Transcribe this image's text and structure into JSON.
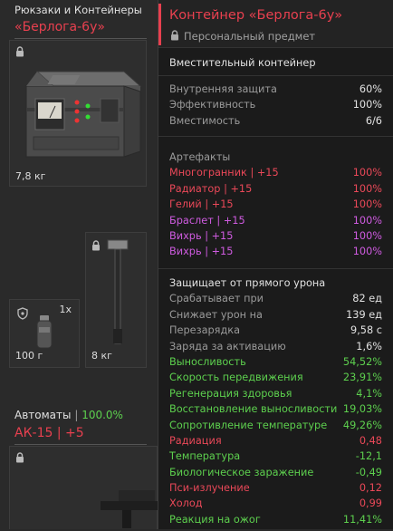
{
  "inventory": {
    "category_title": "Рюкзаки и Контейнеры",
    "item_name": "«Берлога-6у»",
    "container_weight": "7,8 кг",
    "grenade": {
      "count": "1х",
      "weight": "100 г"
    },
    "hammer": {
      "weight": "8 кг"
    },
    "weapons": {
      "category_label": "Автоматы",
      "separator": "|",
      "percent": "100.0%",
      "item_name": "АК-15",
      "upgrade": "| +5"
    }
  },
  "tooltip": {
    "title": "Контейнер «Берлога-6у»",
    "subtitle": "Персональный предмет",
    "type": "Вместительный контейнер",
    "basic_stats": [
      {
        "label": "Внутренняя защита",
        "value": "60%"
      },
      {
        "label": "Эффективность",
        "value": "100%"
      },
      {
        "label": "Вместимость",
        "value": "6/6"
      }
    ],
    "artifacts_header": "Артефакты",
    "artifacts": [
      {
        "label": "Многогранник | +15",
        "value": "100%",
        "color": "#ea4858"
      },
      {
        "label": "Радиатор | +15",
        "value": "100%",
        "color": "#ea4858"
      },
      {
        "label": "Гелий | +15",
        "value": "100%",
        "color": "#ea4858"
      },
      {
        "label": "Браслет | +15",
        "value": "100%",
        "color": "#cf5be0"
      },
      {
        "label": "Вихрь | +15",
        "value": "100%",
        "color": "#cf5be0"
      },
      {
        "label": "Вихрь | +15",
        "value": "100%",
        "color": "#cf5be0"
      }
    ],
    "protection_header": "Защищает от прямого урона",
    "protection": [
      {
        "label": "Срабатывает при",
        "value": "82 ед",
        "color": "#9a9a9a",
        "vcolor": "#e2e2e2"
      },
      {
        "label": "Снижает урон на",
        "value": "139 ед",
        "color": "#9a9a9a",
        "vcolor": "#e2e2e2"
      },
      {
        "label": "Перезарядка",
        "value": "9,58 с",
        "color": "#9a9a9a",
        "vcolor": "#e2e2e2"
      },
      {
        "label": "Заряда за активацию",
        "value": "1,6%",
        "color": "#9a9a9a",
        "vcolor": "#e2e2e2"
      }
    ],
    "effects": [
      {
        "label": "Выносливость",
        "value": "54,52%",
        "color": "#5dd04e"
      },
      {
        "label": "Скорость передвижения",
        "value": "23,91%",
        "color": "#5dd04e"
      },
      {
        "label": "Регенерация здоровья",
        "value": "4,1%",
        "color": "#5dd04e"
      },
      {
        "label": "Восстановление выносливости",
        "value": "19,03%",
        "color": "#5dd04e"
      },
      {
        "label": "Сопротивление температуре",
        "value": "49,26%",
        "color": "#5dd04e"
      },
      {
        "label": "Радиация",
        "value": "0,48",
        "color": "#ea4858"
      },
      {
        "label": "Температура",
        "value": "-12,1",
        "color": "#5dd04e"
      },
      {
        "label": "Биологическое заражение",
        "value": "-0,49",
        "color": "#5dd04e"
      },
      {
        "label": "Пси-излучение",
        "value": "0,12",
        "color": "#ea4858"
      },
      {
        "label": "Холод",
        "value": "0,99",
        "color": "#ea4858"
      },
      {
        "label": "Реакция на ожог",
        "value": "11,41%",
        "color": "#5dd04e"
      }
    ]
  }
}
